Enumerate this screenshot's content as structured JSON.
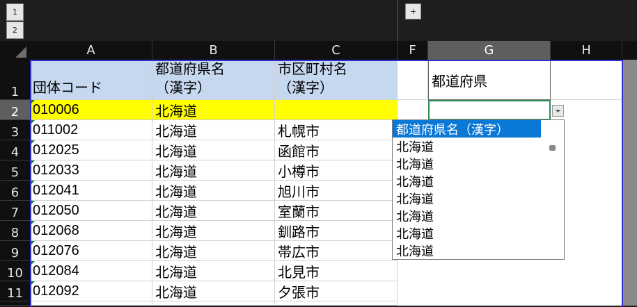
{
  "outline": {
    "level1": "1",
    "level2": "2",
    "expand": "+"
  },
  "columns": [
    "A",
    "B",
    "C",
    "F",
    "G",
    "H"
  ],
  "rows": [
    "1",
    "2",
    "3",
    "4",
    "5",
    "6",
    "7",
    "8",
    "9",
    "10",
    "11"
  ],
  "header_cells": {
    "a": "団体コード",
    "b": "都道府県名\n（漢字）",
    "c": "市区町村名\n（漢字）",
    "g": "都道府県"
  },
  "data_rows": [
    {
      "code": "010006",
      "pref": "北海道",
      "city": ""
    },
    {
      "code": "011002",
      "pref": "北海道",
      "city": "札幌市"
    },
    {
      "code": "012025",
      "pref": "北海道",
      "city": "函館市"
    },
    {
      "code": "012033",
      "pref": "北海道",
      "city": "小樽市"
    },
    {
      "code": "012041",
      "pref": "北海道",
      "city": "旭川市"
    },
    {
      "code": "012050",
      "pref": "北海道",
      "city": "室蘭市"
    },
    {
      "code": "012068",
      "pref": "北海道",
      "city": "釧路市"
    },
    {
      "code": "012076",
      "pref": "北海道",
      "city": "帯広市"
    },
    {
      "code": "012084",
      "pref": "北海道",
      "city": "北見市"
    },
    {
      "code": "012092",
      "pref": "北海道",
      "city": "夕張市"
    }
  ],
  "dropdown": {
    "items": [
      "都道府県名（漢字）",
      "北海道",
      "北海道",
      "北海道",
      "北海道",
      "北海道",
      "北海道",
      "北海道"
    ]
  },
  "colors": {
    "header_fill": "#c6d8ef",
    "highlight": "#ffff00",
    "selection": "#0a78d7",
    "border": "#2f2fd0"
  }
}
